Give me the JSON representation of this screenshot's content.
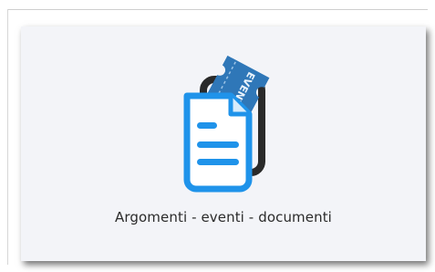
{
  "card": {
    "label": "Argomenti - eventi - documenti",
    "icon": "documents-events-icon",
    "ticket_text": "EVENT"
  },
  "colors": {
    "card_background": "#f3f4f8",
    "icon_blue": "#1f93ea",
    "icon_dark": "#2a2a2a",
    "ticket_blue": "#2f77b8",
    "text": "#2b2b2b"
  }
}
